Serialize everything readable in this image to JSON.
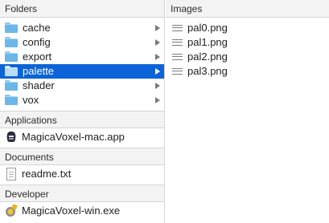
{
  "left_column": {
    "header": "Folders",
    "folders": [
      {
        "label": "cache",
        "selected": false
      },
      {
        "label": "config",
        "selected": false
      },
      {
        "label": "export",
        "selected": false
      },
      {
        "label": "palette",
        "selected": true
      },
      {
        "label": "shader",
        "selected": false
      },
      {
        "label": "vox",
        "selected": false
      }
    ]
  },
  "sections": {
    "applications": {
      "header": "Applications",
      "item": "MagicaVoxel-mac.app",
      "icon": "magicavoxel-app-icon"
    },
    "documents": {
      "header": "Documents",
      "item": "readme.txt",
      "icon": "text-document-icon"
    },
    "developer": {
      "header": "Developer",
      "item": "MagicaVoxel-win.exe",
      "icon": "exe-gear-icon"
    }
  },
  "right_column": {
    "header": "Images",
    "files": [
      "pal0.png",
      "pal1.png",
      "pal2.png",
      "pal3.png"
    ]
  },
  "colors": {
    "selection": "#0d63d8",
    "folder": "#6bb7e8",
    "header_bg": "#f3f3f3"
  }
}
